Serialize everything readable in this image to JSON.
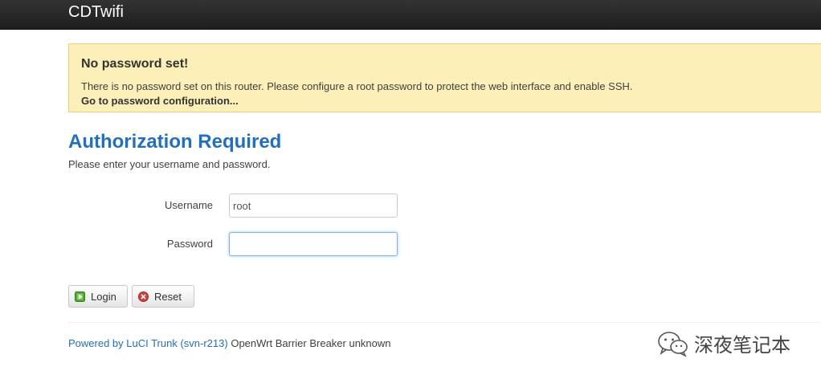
{
  "header": {
    "brand": "CDTwifi"
  },
  "alert": {
    "title": "No password set!",
    "message": "There is no password set on this router. Please configure a root password to protect the web interface and enable SSH.",
    "link_label": "Go to password configuration..."
  },
  "auth": {
    "title": "Authorization Required",
    "description": "Please enter your username and password."
  },
  "form": {
    "username_label": "Username",
    "username_value": "root",
    "password_label": "Password",
    "password_value": ""
  },
  "buttons": {
    "login_label": "Login",
    "reset_label": "Reset"
  },
  "footer": {
    "powered_by": "Powered by LuCI Trunk (svn-r213)",
    "version": "OpenWrt Barrier Breaker unknown"
  },
  "watermark": {
    "text": "深夜笔记本",
    "icon": "wechat-icon"
  },
  "colors": {
    "topbar": "#222222",
    "alert_bg": "#fcf0b8",
    "link_blue": "#1f6fc5",
    "login_icon": "#4caf2a",
    "reset_icon": "#d43f3a"
  }
}
